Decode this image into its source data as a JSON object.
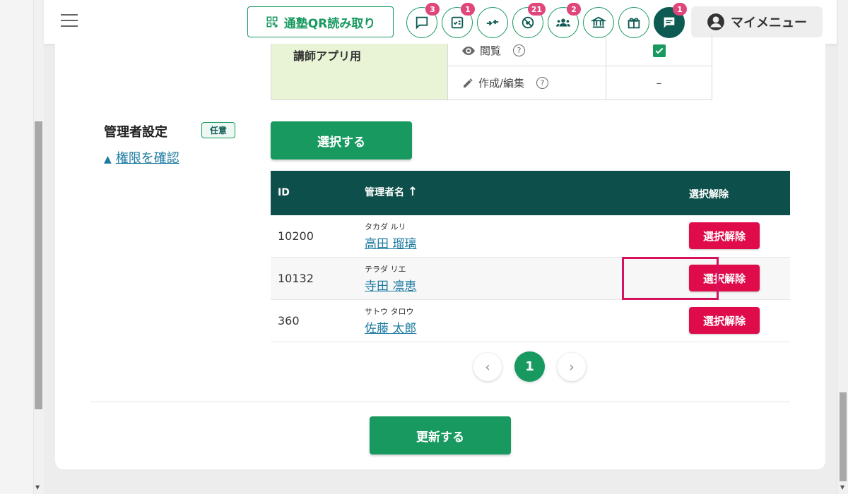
{
  "header": {
    "qr_button_label": "通塾QR読み取り",
    "icons": [
      {
        "name": "message-icon",
        "badge": "3"
      },
      {
        "name": "checklist-icon",
        "badge": "1"
      },
      {
        "name": "transfer-icon",
        "badge": ""
      },
      {
        "name": "blocked-icon",
        "badge": "21"
      },
      {
        "name": "group-icon",
        "badge": "2"
      },
      {
        "name": "school-icon",
        "badge": ""
      },
      {
        "name": "gift-icon",
        "badge": ""
      },
      {
        "name": "chat-icon",
        "badge": "1"
      }
    ],
    "my_menu_label": "マイメニュー"
  },
  "permissions": {
    "app_label": "講師アプリ用",
    "rows": [
      {
        "label": "閲覧",
        "help": "?",
        "value": "checked"
      },
      {
        "label": "作成/編集",
        "help": "?",
        "value": "–"
      }
    ]
  },
  "admin": {
    "label": "管理者設定",
    "optional_badge": "任意",
    "permission_link": "権限を確認",
    "permission_link_marker": "▲",
    "select_button": "選択する",
    "columns": {
      "id": "ID",
      "name": "管理者名",
      "action": "選択解除"
    },
    "sort_indicator": "↑",
    "rows": [
      {
        "id": "10200",
        "kana": "タカダ ルリ",
        "name": "高田 瑠璃",
        "action": "選択解除"
      },
      {
        "id": "10132",
        "kana": "テラダ リエ",
        "name": "寺田 凛恵",
        "action": "選択解除"
      },
      {
        "id": "360",
        "kana": "サトウ タロウ",
        "name": "佐藤 太郎",
        "action": "選択解除"
      }
    ]
  },
  "pagination": {
    "prev": "‹",
    "current": "1",
    "next": "›"
  },
  "update_button": "更新する",
  "colors": {
    "primary": "#17995f",
    "dark_teal": "#0d4f4a",
    "danger": "#df0b4b",
    "badge": "#e0457b",
    "link": "#1b7aa0"
  }
}
